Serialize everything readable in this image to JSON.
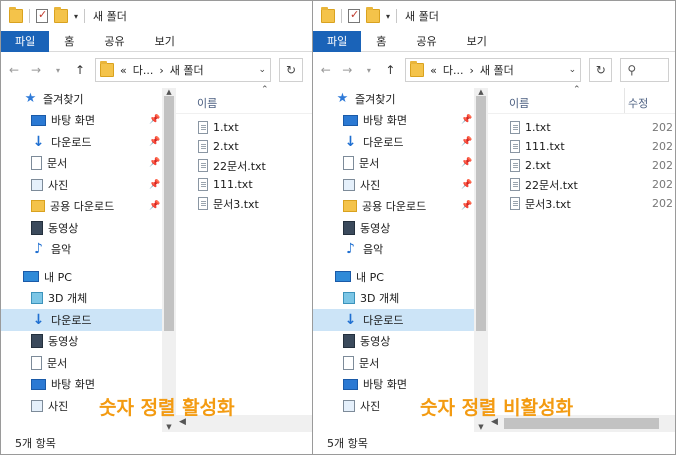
{
  "windows": [
    {
      "id": "left",
      "title": "새 폴더",
      "ribbon_tabs": [
        "파일",
        "홈",
        "공유",
        "보기"
      ],
      "address": {
        "overflow": "«",
        "path": [
          "다...",
          "새 폴더"
        ]
      },
      "search_placeholder": "",
      "nav": [
        {
          "label": "즐겨찾기",
          "icon": "star-icon",
          "type": "group",
          "pinned": false
        },
        {
          "label": "바탕 화면",
          "icon": "desktop-icon",
          "type": "item",
          "pinned": true
        },
        {
          "label": "다운로드",
          "icon": "download-icon",
          "type": "item",
          "pinned": true
        },
        {
          "label": "문서",
          "icon": "document-icon",
          "type": "item",
          "pinned": true
        },
        {
          "label": "사진",
          "icon": "pictures-icon",
          "type": "item",
          "pinned": true
        },
        {
          "label": "공용 다운로드",
          "icon": "folder-icon",
          "type": "item",
          "pinned": true
        },
        {
          "label": "동영상",
          "icon": "video-icon",
          "type": "item",
          "pinned": false
        },
        {
          "label": "음악",
          "icon": "music-icon",
          "type": "item",
          "pinned": false
        },
        {
          "label": "내 PC",
          "icon": "pc-icon",
          "type": "group",
          "pinned": false
        },
        {
          "label": "3D 개체",
          "icon": "3d-objects-icon",
          "type": "item",
          "pinned": false
        },
        {
          "label": "다운로드",
          "icon": "download-icon",
          "type": "item",
          "pinned": false,
          "selected": true
        },
        {
          "label": "동영상",
          "icon": "video-icon",
          "type": "item",
          "pinned": false
        },
        {
          "label": "문서",
          "icon": "document-icon",
          "type": "item",
          "pinned": false
        },
        {
          "label": "바탕 화면",
          "icon": "desktop-icon",
          "type": "item",
          "pinned": false
        },
        {
          "label": "사진",
          "icon": "pictures-icon",
          "type": "item",
          "pinned": false
        }
      ],
      "columns": {
        "name": "이름",
        "modified": ""
      },
      "files": [
        {
          "name": "1.txt",
          "date": ""
        },
        {
          "name": "2.txt",
          "date": ""
        },
        {
          "name": "22문서.txt",
          "date": ""
        },
        {
          "name": "111.txt",
          "date": ""
        },
        {
          "name": "문서3.txt",
          "date": ""
        }
      ],
      "status": "5개 항목",
      "caption": "숫자 정렬 활성화"
    },
    {
      "id": "right",
      "title": "새 폴더",
      "ribbon_tabs": [
        "파일",
        "홈",
        "공유",
        "보기"
      ],
      "address": {
        "overflow": "«",
        "path": [
          "다...",
          "새 폴더"
        ]
      },
      "search_placeholder": "",
      "nav": [
        {
          "label": "즐겨찾기",
          "icon": "star-icon",
          "type": "group",
          "pinned": false
        },
        {
          "label": "바탕 화면",
          "icon": "desktop-icon",
          "type": "item",
          "pinned": true
        },
        {
          "label": "다운로드",
          "icon": "download-icon",
          "type": "item",
          "pinned": true
        },
        {
          "label": "문서",
          "icon": "document-icon",
          "type": "item",
          "pinned": true
        },
        {
          "label": "사진",
          "icon": "pictures-icon",
          "type": "item",
          "pinned": true
        },
        {
          "label": "공용 다운로드",
          "icon": "folder-icon",
          "type": "item",
          "pinned": true
        },
        {
          "label": "동영상",
          "icon": "video-icon",
          "type": "item",
          "pinned": false
        },
        {
          "label": "음악",
          "icon": "music-icon",
          "type": "item",
          "pinned": false
        },
        {
          "label": "내 PC",
          "icon": "pc-icon",
          "type": "group",
          "pinned": false
        },
        {
          "label": "3D 개체",
          "icon": "3d-objects-icon",
          "type": "item",
          "pinned": false
        },
        {
          "label": "다운로드",
          "icon": "download-icon",
          "type": "item",
          "pinned": false,
          "selected": true
        },
        {
          "label": "동영상",
          "icon": "video-icon",
          "type": "item",
          "pinned": false
        },
        {
          "label": "문서",
          "icon": "document-icon",
          "type": "item",
          "pinned": false
        },
        {
          "label": "바탕 화면",
          "icon": "desktop-icon",
          "type": "item",
          "pinned": false
        },
        {
          "label": "사진",
          "icon": "pictures-icon",
          "type": "item",
          "pinned": false
        }
      ],
      "columns": {
        "name": "이름",
        "modified": "수정"
      },
      "files": [
        {
          "name": "1.txt",
          "date": "202"
        },
        {
          "name": "111.txt",
          "date": "202"
        },
        {
          "name": "2.txt",
          "date": "202"
        },
        {
          "name": "22문서.txt",
          "date": "202"
        },
        {
          "name": "문서3.txt",
          "date": "202"
        }
      ],
      "status": "5개 항목",
      "caption": "숫자 정렬 비활성화"
    }
  ],
  "colors": {
    "accent": "#1a63b8",
    "selection": "#cce4f7",
    "caption": "#f39b12"
  }
}
